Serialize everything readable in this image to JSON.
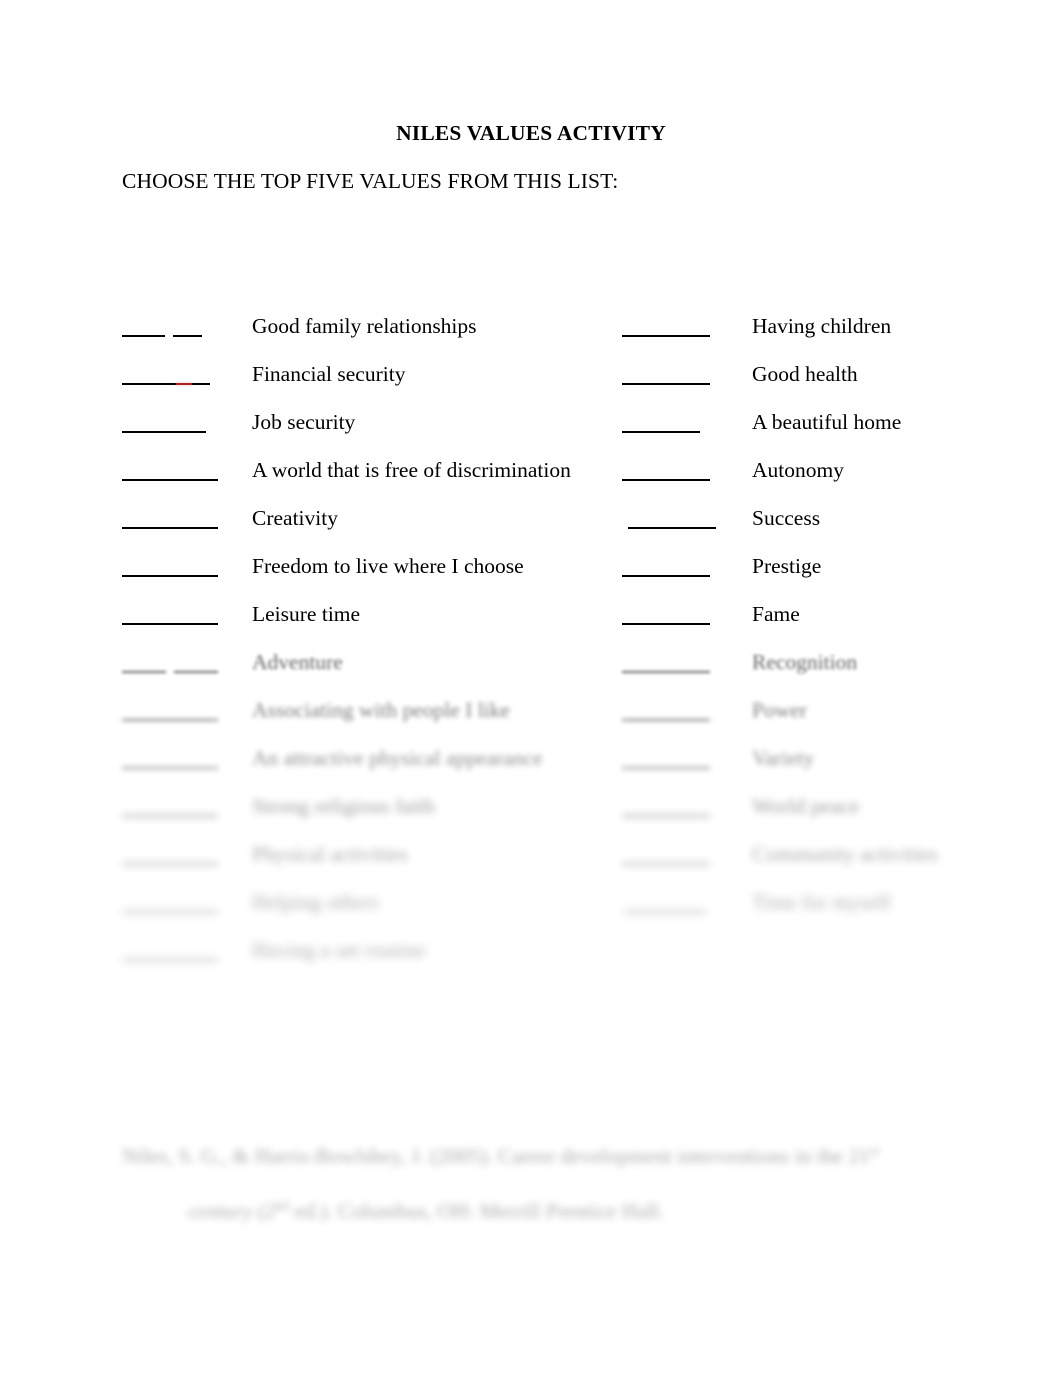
{
  "document": {
    "title": "NILES VALUES ACTIVITY",
    "instruction": "CHOOSE THE TOP FIVE VALUES FROM THIS LIST:"
  },
  "values": {
    "left_column": [
      {
        "label": "Good family relationships",
        "blank": "____ ___",
        "legible": true
      },
      {
        "label": "Financial security",
        "blank": "____ ____",
        "legible": true
      },
      {
        "label": "Job security",
        "blank": "________",
        "legible": true
      },
      {
        "label": "A world that is free of discrimination",
        "blank": "_________",
        "legible": true
      },
      {
        "label": "Creativity",
        "blank": "_________",
        "legible": true
      },
      {
        "label": "Freedom to live where I choose",
        "blank": "_________",
        "legible": true
      },
      {
        "label": "Leisure time",
        "blank": "_________",
        "legible": true
      },
      {
        "label": "Adventure",
        "blank": "____ ____",
        "legible": true
      },
      {
        "label": "Associating with people I like",
        "blank": "_________",
        "legible": false
      },
      {
        "label": "An attractive physical appearance",
        "blank": "_________",
        "legible": false
      },
      {
        "label": "Strong religious faith",
        "blank": "_________",
        "legible": false
      },
      {
        "label": "Physical activities",
        "blank": "_________",
        "legible": false
      },
      {
        "label": "Helping others",
        "blank": "_________",
        "legible": false
      },
      {
        "label": "Having a set routine",
        "blank": "_________",
        "legible": false
      }
    ],
    "right_column": [
      {
        "label": "Having children",
        "blank": "________",
        "legible": true
      },
      {
        "label": "Good health",
        "blank": "________",
        "legible": true
      },
      {
        "label": "A beautiful home",
        "blank": "_______",
        "legible": true
      },
      {
        "label": "Autonomy",
        "blank": "________",
        "legible": true
      },
      {
        "label": "Success",
        "blank": "________",
        "legible": true
      },
      {
        "label": "Prestige",
        "blank": "________",
        "legible": true
      },
      {
        "label": "Fame",
        "blank": "________",
        "legible": true
      },
      {
        "label": "Recognition",
        "blank": "________",
        "legible": false
      },
      {
        "label": "Power",
        "blank": "________",
        "legible": false
      },
      {
        "label": "Variety",
        "blank": "________",
        "legible": false
      },
      {
        "label": "World peace",
        "blank": "________",
        "legible": false
      },
      {
        "label": "Community activities",
        "blank": "________",
        "legible": false
      },
      {
        "label": "Time for myself",
        "blank": "________",
        "legible": false
      }
    ]
  },
  "citation": {
    "line1": "Niles, S. G., & Harris-Bowlsbey, J. (2005). Career development interventions in the 21",
    "line1_sup": "st",
    "line2": "century (2",
    "line2_sup": "nd",
    "line2_rest": " ed.). Columbus, OH: Merrill Prentice Hall."
  },
  "colors": {
    "text": "#000000",
    "background": "#ffffff",
    "blank_rule": "#000000",
    "spellcheck_mark": "#ff0000"
  }
}
